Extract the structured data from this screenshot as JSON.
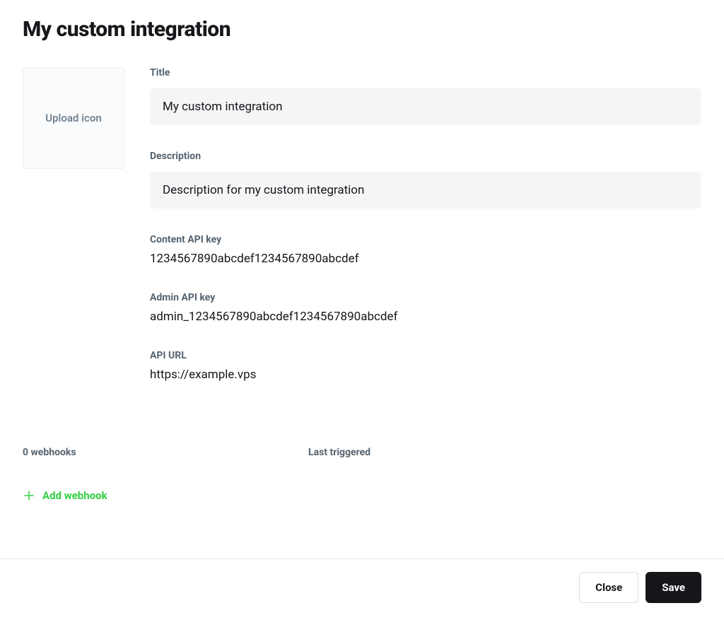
{
  "header": {
    "title": "My custom integration"
  },
  "upload": {
    "label": "Upload icon"
  },
  "fields": {
    "title": {
      "label": "Title",
      "value": "My custom integration"
    },
    "description": {
      "label": "Description",
      "value": "Description for my custom integration"
    },
    "content_api_key": {
      "label": "Content API key",
      "value": "1234567890abcdef1234567890abcdef"
    },
    "admin_api_key": {
      "label": "Admin API key",
      "value": "admin_1234567890abcdef1234567890abcdef"
    },
    "api_url": {
      "label": "API URL",
      "value": "https://example.vps"
    }
  },
  "webhooks": {
    "count_label": "0 webhooks",
    "last_triggered_label": "Last triggered",
    "add_label": "Add webhook"
  },
  "footer": {
    "close": "Close",
    "save": "Save"
  }
}
